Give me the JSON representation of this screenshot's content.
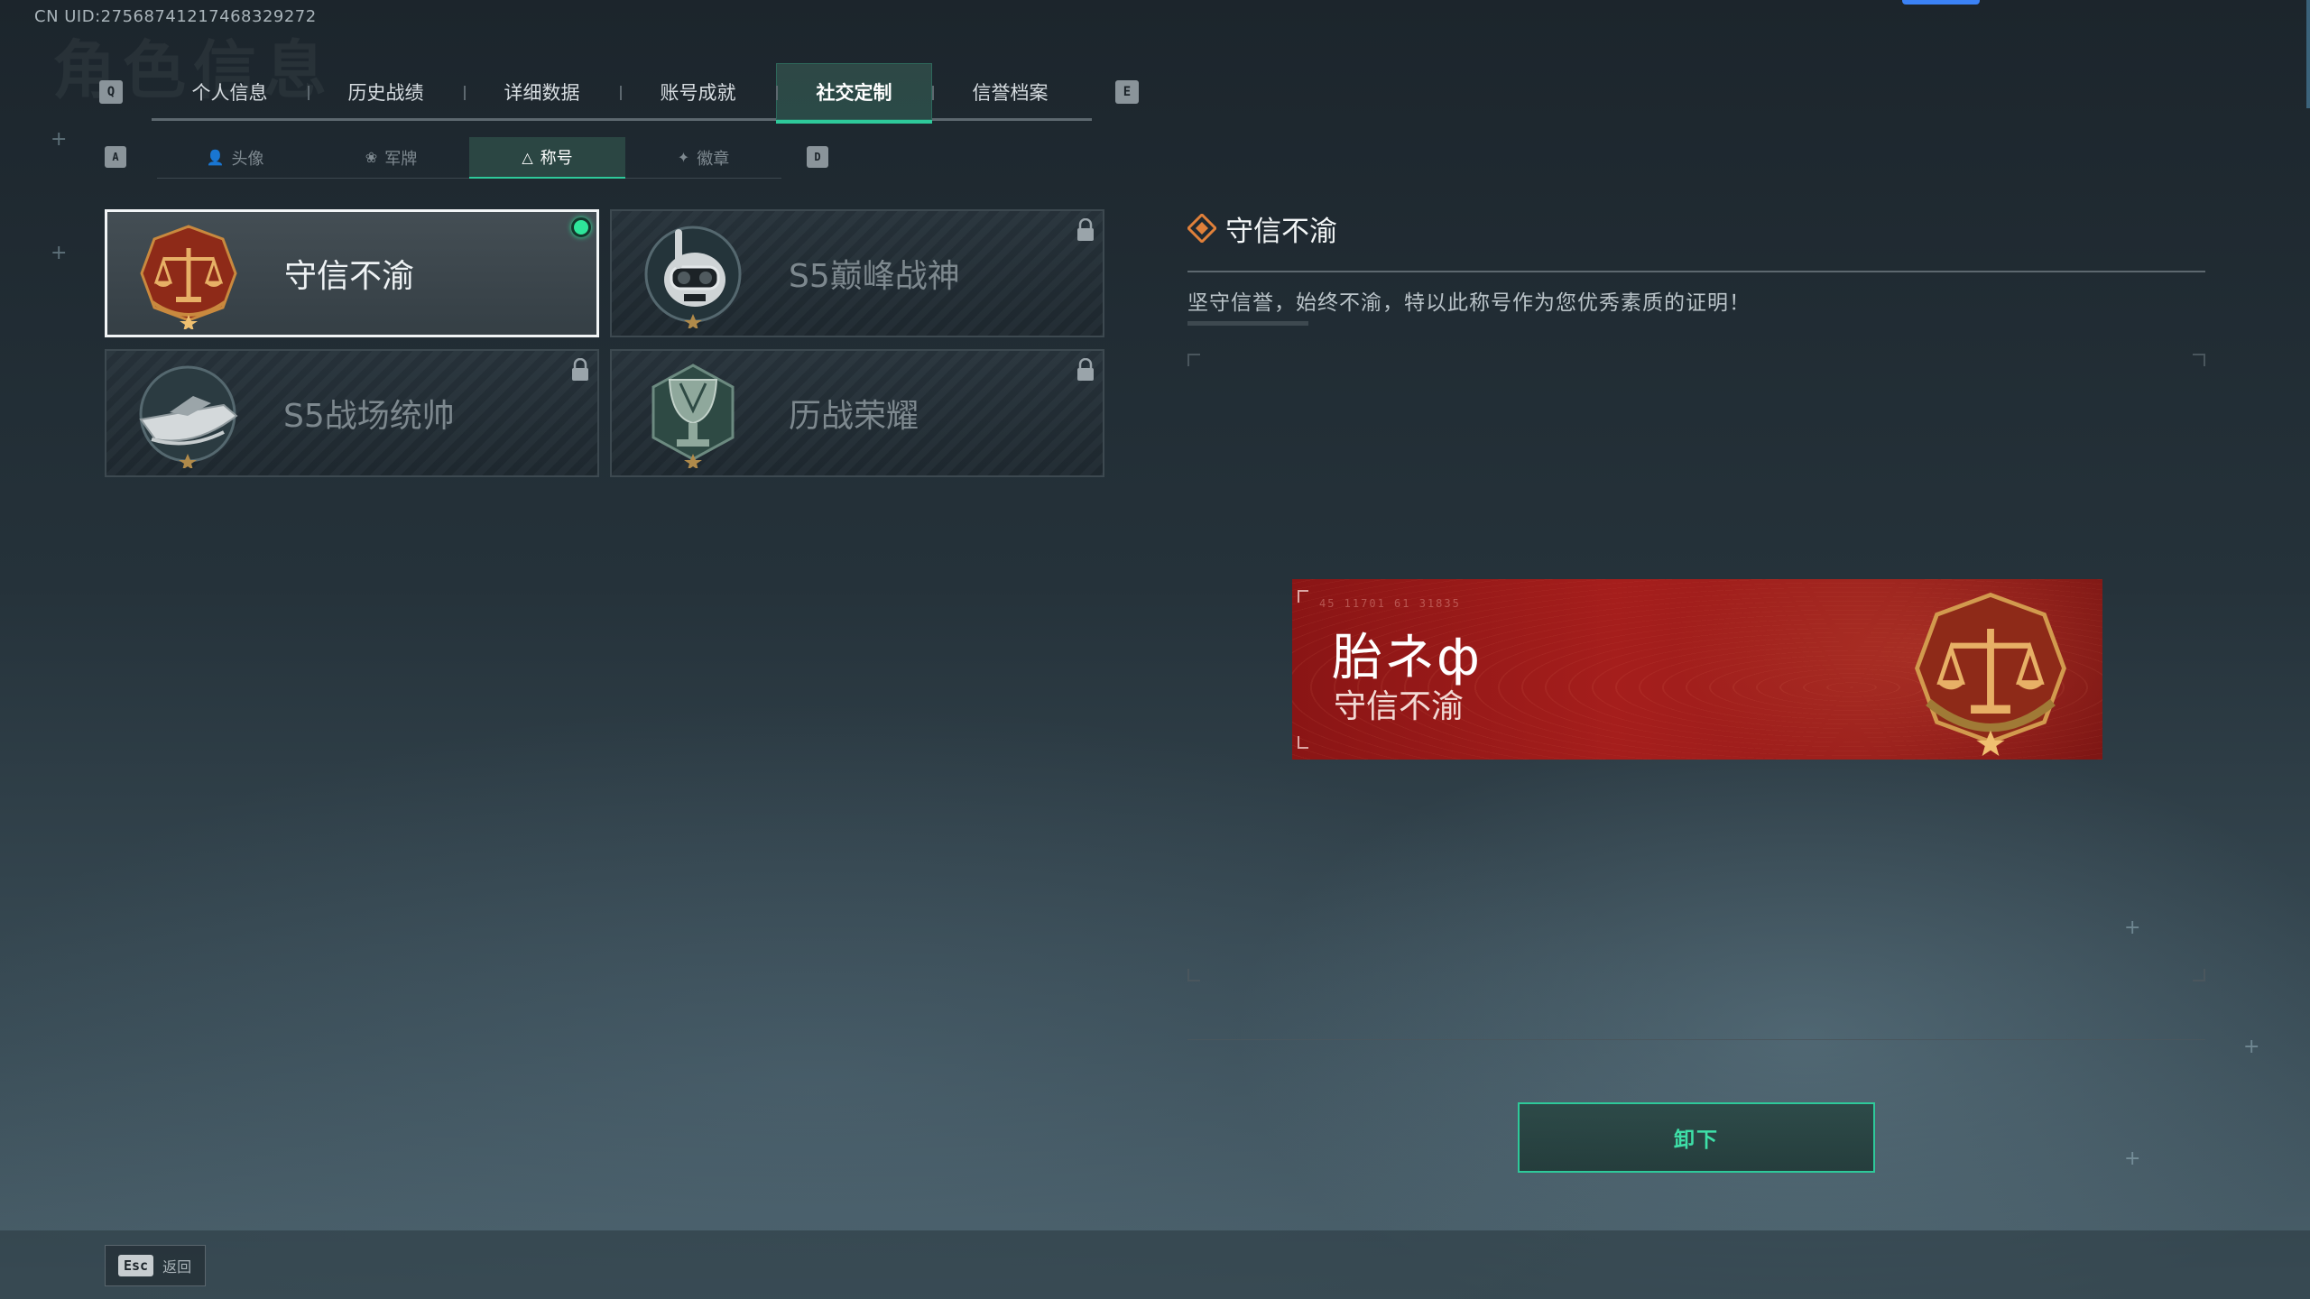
{
  "uid": "CN UID:27568741217468329272",
  "ghost_title": "角色信息",
  "main_tabs": {
    "left_key": "Q",
    "right_key": "E",
    "items": [
      {
        "label": "个人信息"
      },
      {
        "label": "历史战绩"
      },
      {
        "label": "详细数据"
      },
      {
        "label": "账号成就"
      },
      {
        "label": "社交定制",
        "active": true
      },
      {
        "label": "信誉档案"
      }
    ]
  },
  "sub_tabs": {
    "left_key": "A",
    "right_key": "D",
    "items": [
      {
        "label": "头像",
        "icon": "person-icon"
      },
      {
        "label": "军牌",
        "icon": "dogtag-icon"
      },
      {
        "label": "称号",
        "icon": "title-icon",
        "active": true
      },
      {
        "label": "徽章",
        "icon": "badge-icon"
      }
    ]
  },
  "titles": [
    {
      "name": "守信不渝",
      "emblem": "scales-emblem",
      "state": "equipped"
    },
    {
      "name": "S5巅峰战神",
      "emblem": "diver-skull-emblem",
      "state": "locked"
    },
    {
      "name": "S5战场统帅",
      "emblem": "speedboat-emblem",
      "state": "locked"
    },
    {
      "name": "历战荣耀",
      "emblem": "trophy-emblem",
      "state": "locked"
    }
  ],
  "detail": {
    "title": "守信不渝",
    "description": "坚守信誉，始终不渝，特以此称号作为您优秀素质的证明！"
  },
  "banner": {
    "player_name": "胎ネф",
    "title": "守信不渝",
    "codes": "45 11701   61 31835"
  },
  "actions": {
    "unequip_label": "卸下"
  },
  "footer": {
    "esc_key": "Esc",
    "back_label": "返回"
  },
  "colors": {
    "accent_green": "#2ec99a",
    "banner_red": "#a51e1c",
    "equipped_dot": "#2ee59a"
  }
}
